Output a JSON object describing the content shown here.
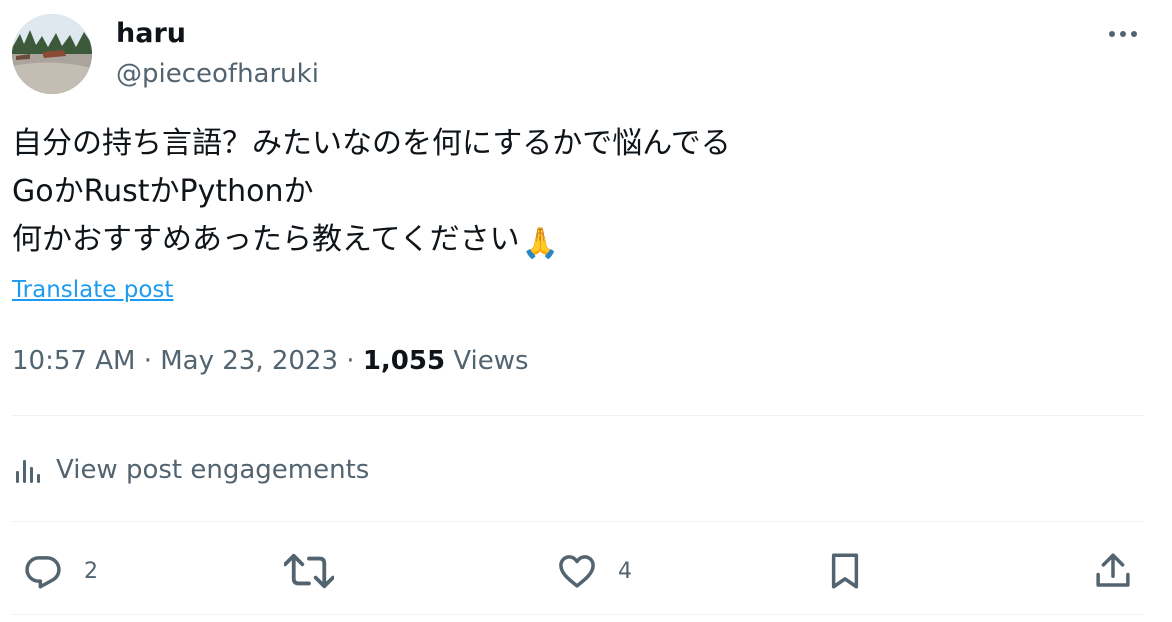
{
  "author": {
    "display_name": "haru",
    "handle": "@pieceofharuki"
  },
  "post": {
    "lines": [
      "自分の持ち言語？みたいなのを何にするかで悩んでる",
      "GoかRustかPythonか",
      "何かおすすめあったら教えてください"
    ],
    "trailing_emoji": "🙏",
    "translate_label": "Translate post"
  },
  "meta": {
    "time": "10:57 AM",
    "date": "May 23, 2023",
    "separator": "·",
    "views_count": "1,055",
    "views_label": "Views"
  },
  "engagements": {
    "label": "View post engagements",
    "icon": "analytics-icon"
  },
  "actions": {
    "reply_count": "2",
    "repost_count": "",
    "like_count": "4",
    "icons": [
      "reply-icon",
      "repost-icon",
      "like-icon",
      "bookmark-icon",
      "share-icon"
    ]
  },
  "colors": {
    "text_primary": "#0f1419",
    "text_secondary": "#536471",
    "link": "#1d9bf0",
    "divider": "#eff3f4"
  }
}
